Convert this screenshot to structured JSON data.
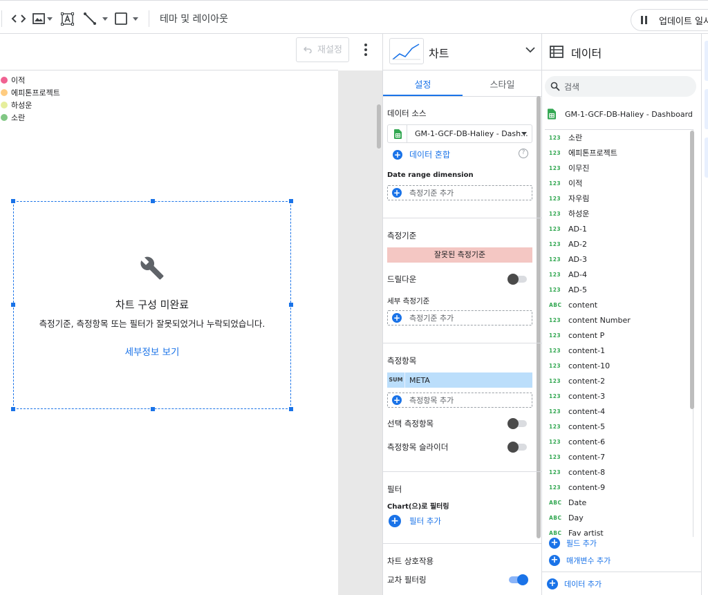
{
  "toolbar": {
    "theme_label": "테마 및 레이아웃",
    "update_label": "업데이트 일시"
  },
  "canvas": {
    "reset_label": "재설정",
    "legend": [
      {
        "label": "이적",
        "color": "#f06292"
      },
      {
        "label": "에피톤프로젝트",
        "color": "#ffcc80"
      },
      {
        "label": "하성운",
        "color": "#e6ee9c"
      },
      {
        "label": "소란",
        "color": "#81c784"
      }
    ],
    "error_title": "차트 구성 미완료",
    "error_desc": "측정기준, 측정항목 또는 필터가 잘못되었거나 누락되었습니다.",
    "error_link": "세부정보 보기"
  },
  "chart_panel": {
    "title": "차트",
    "tabs": [
      "설정",
      "스타일"
    ],
    "data_source_title": "데이터 소스",
    "data_source_name": "GM-1-GCF-DB-Haliey - Dash...",
    "blend_label": "데이터 혼합",
    "date_range_title": "Date range dimension",
    "add_dimension": "측정기준 추가",
    "dimension_title": "측정기준",
    "invalid_dimension": "잘못된 측정기준",
    "drilldown_label": "드릴다운",
    "breakdown_title": "세부 측정기준",
    "metric_title": "측정항목",
    "metric_agg": "SUM",
    "metric_name": "META",
    "add_metric": "측정항목 추가",
    "optional_metric": "선택 측정항목",
    "metric_slider": "측정항목 슬라이더",
    "filter_title": "필터",
    "filter_sub": "Chart(으)로 필터링",
    "add_filter": "필터 추가",
    "interaction_title": "차트 상호작용",
    "cross_filter": "교차 필터링"
  },
  "data_panel": {
    "title": "데이터",
    "search_placeholder": "검색",
    "source_name": "GM-1-GCF-DB-Haliey - Dashboard",
    "fields": [
      {
        "type": "123",
        "name": "소란"
      },
      {
        "type": "123",
        "name": "에피톤프로젝트"
      },
      {
        "type": "123",
        "name": "이무진"
      },
      {
        "type": "123",
        "name": "이적"
      },
      {
        "type": "123",
        "name": "자우림"
      },
      {
        "type": "123",
        "name": "하성운"
      },
      {
        "type": "123",
        "name": "AD-1"
      },
      {
        "type": "123",
        "name": "AD-2"
      },
      {
        "type": "123",
        "name": "AD-3"
      },
      {
        "type": "123",
        "name": "AD-4"
      },
      {
        "type": "123",
        "name": "AD-5"
      },
      {
        "type": "ABC",
        "name": "content"
      },
      {
        "type": "123",
        "name": "content Number"
      },
      {
        "type": "123",
        "name": "content P"
      },
      {
        "type": "123",
        "name": "content-1"
      },
      {
        "type": "123",
        "name": "content-10"
      },
      {
        "type": "123",
        "name": "content-2"
      },
      {
        "type": "123",
        "name": "content-3"
      },
      {
        "type": "123",
        "name": "content-4"
      },
      {
        "type": "123",
        "name": "content-5"
      },
      {
        "type": "123",
        "name": "content-6"
      },
      {
        "type": "123",
        "name": "content-7"
      },
      {
        "type": "123",
        "name": "content-8"
      },
      {
        "type": "123",
        "name": "content-9"
      },
      {
        "type": "ABC",
        "name": "Date"
      },
      {
        "type": "ABC",
        "name": "Day"
      },
      {
        "type": "ABC",
        "name": "Fav artist"
      }
    ],
    "add_field": "필드 추가",
    "add_param": "매개변수 추가",
    "add_data": "데이터 추가"
  },
  "colors": {
    "accent": "#1a73e8",
    "invalid": "#f4c7c3",
    "metric_chip": "#bbdefb",
    "sheets_green": "#34a853"
  }
}
